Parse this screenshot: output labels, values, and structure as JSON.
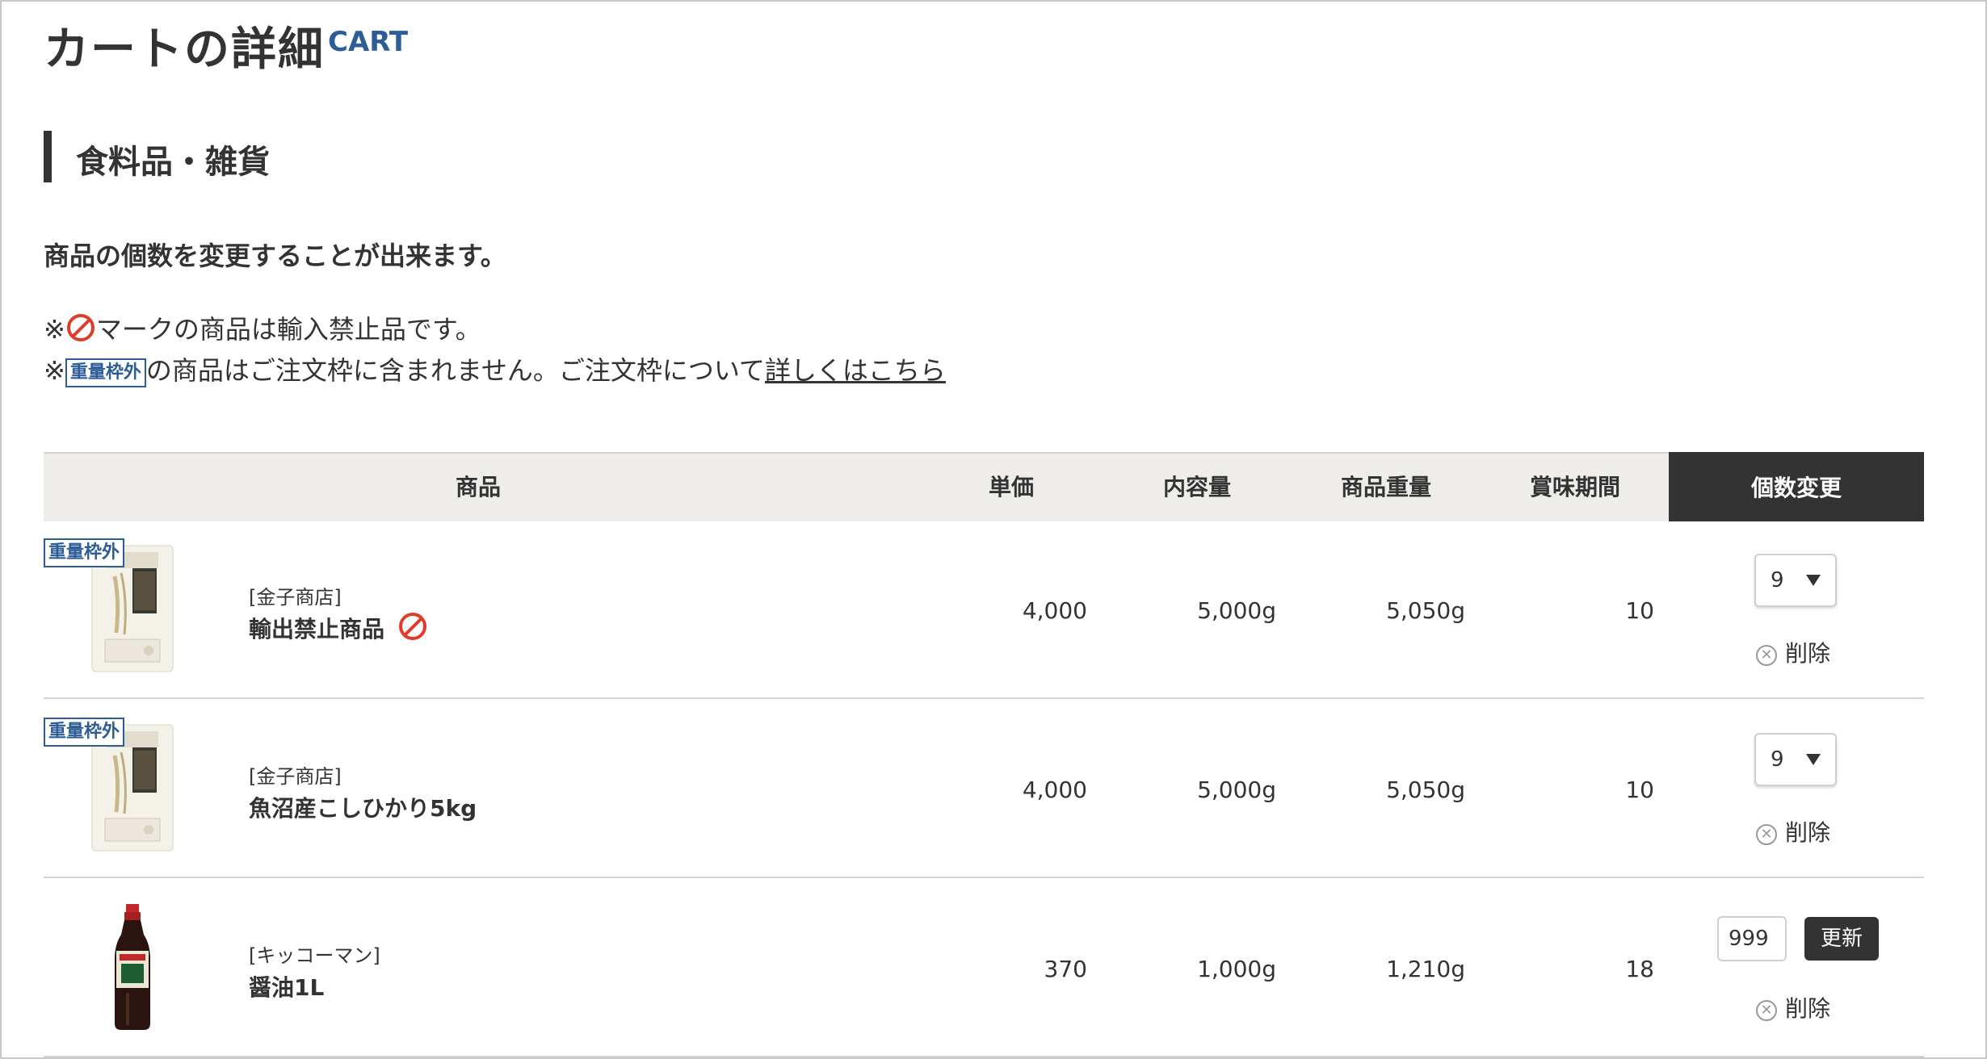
{
  "page": {
    "title": "カートの詳細",
    "subtitle": "CART"
  },
  "section": {
    "title": "食料品・雑貨"
  },
  "lead": "商品の個数を変更することが出来ます。",
  "notes": {
    "n1_prefix": "※",
    "n1_text": "マークの商品は輸入禁止品です。",
    "n2_prefix": "※",
    "n2_tag": "重量枠外",
    "n2_text": "の商品はご注文枠に含まれません。ご注文枠について",
    "n2_link": "詳しくはこちら"
  },
  "colors": {
    "accent": "#2c5d96",
    "dark": "#333333",
    "ban": "#e03c2c",
    "header_bg": "#efedea"
  },
  "table": {
    "headers": [
      "商品",
      "単価",
      "内容量",
      "商品重量",
      "賞味期間",
      "個数変更"
    ],
    "rows": [
      {
        "tag": "重量枠外",
        "image": "rice-bag",
        "shop": "[金子商店]",
        "name": "輸出禁止商品",
        "banned": true,
        "price": "4,000",
        "volume": "5,000g",
        "weight": "5,050g",
        "shelf": "10",
        "qty": "9",
        "qty_mode": "select",
        "delete": "削除"
      },
      {
        "tag": "重量枠外",
        "image": "rice-bag",
        "shop": "[金子商店]",
        "name": "魚沼産こしひかり5kg",
        "banned": false,
        "price": "4,000",
        "volume": "5,000g",
        "weight": "5,050g",
        "shelf": "10",
        "qty": "9",
        "qty_mode": "select",
        "delete": "削除"
      },
      {
        "tag": "",
        "image": "soy-sauce-bottle",
        "shop": "[キッコーマン]",
        "name": "醤油1L",
        "banned": false,
        "price": "370",
        "volume": "1,000g",
        "weight": "1,210g",
        "shelf": "18",
        "qty": "999",
        "qty_mode": "input",
        "update": "更新",
        "delete": "削除"
      }
    ]
  }
}
